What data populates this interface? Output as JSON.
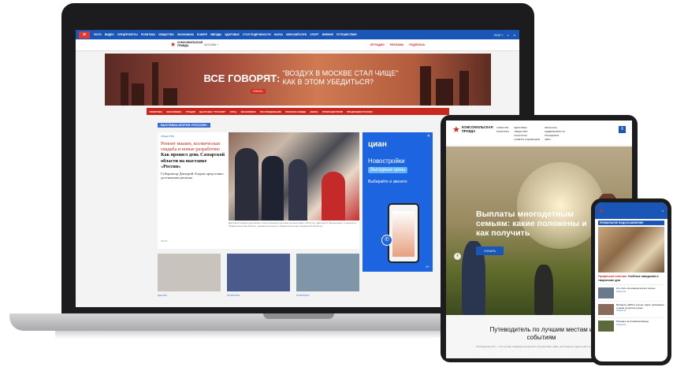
{
  "laptop": {
    "topbar": {
      "menu_icon": "hamburger-icon",
      "nav": [
        "ФОТО",
        "ВИДЕО",
        "СПЕЦПРОЕКТЫ",
        "ПОЛИТИКА",
        "ОБЩЕСТВО",
        "ЭКОНОМИКА",
        "В МИРЕ",
        "ЗВЕЗДЫ",
        "ЗДОРОВЬЕ",
        "СТОЛ ПОДРОБНОСТИ",
        "НАУКА",
        "ЖЕНСКИЙ КЛУБ",
        "СПОРТ",
        "МНЕНИЕ",
        "ПУТЕШЕСТВИЯ"
      ],
      "region": "ПОЛ ˅",
      "search_icon": "search-icon",
      "user_icon": "user-icon"
    },
    "header": {
      "logo_text": "КОМСОМОЛЬСКАЯ ПРАВДА",
      "region_select": "МОСКВА ˅",
      "links": [
        "КП РАДИО",
        "РЕКЛАМА",
        "ПОДПИСКА"
      ]
    },
    "banner": {
      "left": "ВСЕ ГОВОРЯТ:",
      "right_line1": "\"ВОЗДУХ В МОСКВЕ СТАЛ ЧИЩЕ\"",
      "right_line2": "КАК В ЭТОМ УБЕДИТЬСЯ?",
      "button": "УЗНАТЬ"
    },
    "red_nav": [
      "ПОЛИТИКА",
      "ЭКОНОМИКА",
      "ГРЕЦИЯ",
      "ВЫСТАВКА \"РОССИЯ\"",
      "КУРЫ",
      "ЭКОНОМИКА",
      "РАССЛЕДОВАНИЕ",
      "РЕКЛАМА ВНИДЕ",
      "АВИКА",
      "ПРОИСШЕСТВИЯ",
      "ПРОДУКЦИЯ РОССИИ"
    ],
    "forum_tag": "ВЫСТАВКА-ФОРУМ «РОССИЯ»",
    "article": {
      "tag": "ОБЩЕСТВО",
      "headline_red": "Ремонт машин, космическая свадьба и новые разработки:",
      "headline_black": "Как прошел день Самарской области на выставке «Россия»",
      "lede": "Губернатор Дмитрий Азаров представил достижения региона",
      "source": "ФОТО",
      "caption": "Дмитрий Азаров рассказал о достижениях региона на выставке «Россия». Дмитрий Чернышенко и министр Правительства России, провели встречу в Правительстве Самарской области."
    },
    "ad": {
      "logo": "циан",
      "title": "Новостройки",
      "pill": "Выгодные цены",
      "cta": "Выбирайте и звоните",
      "plus": "0+"
    },
    "thumbs": [
      {
        "tag": "ЦЕНТРА",
        "color": "#c9c3be"
      },
      {
        "tag": "ПОЛИТИКА",
        "color": "#4a5a8a"
      },
      {
        "tag": "ПОЛИТИКА",
        "color": "#7f95a8"
      }
    ]
  },
  "tablet": {
    "logo_text": "КОМСОМОЛЬСКАЯ ПРАВДА",
    "menu": [
      "СОБЫТИЯ",
      "ЗДОРОВЬЕ",
      "ФИНАНСЫ",
      "ПОЛИТИКА",
      "ОБЩЕСТВО",
      "НЕДВИЖИМОСТЬ",
      "",
      "КОНКУРСЫ",
      "ПРАЗДНИКИ",
      "",
      "СОВЕТЫ САДОВОДОВ",
      "АВТО"
    ],
    "hero_title": "Выплаты многодетным семьям: какие положены и как получить",
    "hero_button": "УЗНАТЬ",
    "footer_title": "Путеводитель по лучшим местам и событиям",
    "footer_text": "Путеводитель КП — это лучшая подборка интересного путешествия, кафе, ресторанов и других мест для отдыха."
  },
  "phone": {
    "tag": "ПРАВИЛЬНОЕ ВОДОСНАБЖЕНИЕ",
    "headline_red": "Профессия плотник:",
    "headline_black": "Учебные заведения и творческие дни",
    "items": [
      {
        "title": "Кто стать производителем в сезоне",
        "meta": "Общество",
        "color": "#6a7a8a"
      },
      {
        "title": "Выбирать ДОМ в сезоне: какие требования и какие средства нужны",
        "meta": "Общество",
        "color": "#8a6a5a"
      },
      {
        "title": "Позиции на Семейном Ежеду",
        "meta": "Общество",
        "color": "#5a6a3a"
      }
    ]
  }
}
